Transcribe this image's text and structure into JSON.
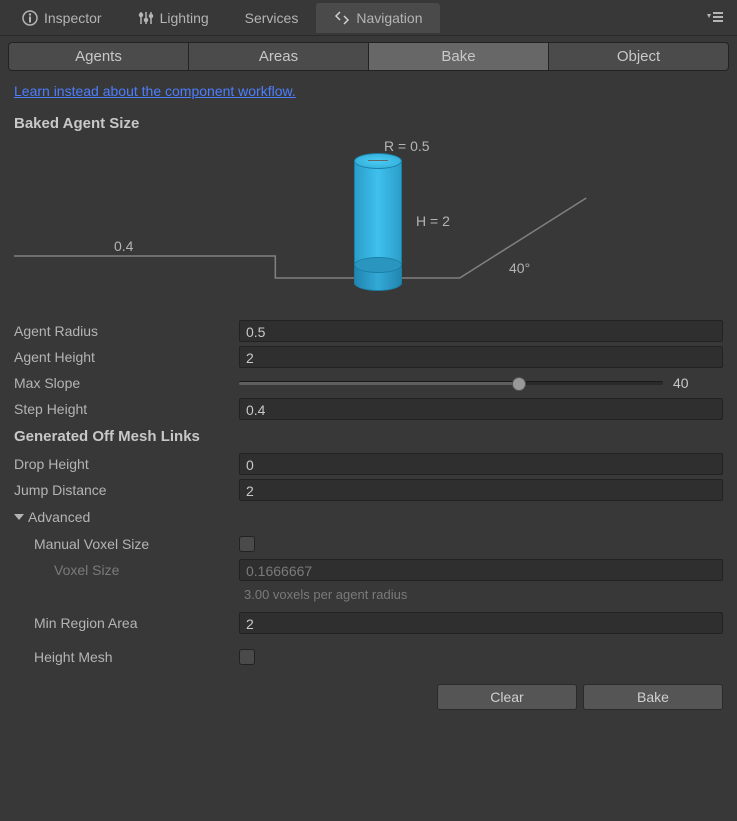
{
  "topTabs": {
    "inspector": "Inspector",
    "lighting": "Lighting",
    "services": "Services",
    "navigation": "Navigation"
  },
  "subTabs": {
    "agents": "Agents",
    "areas": "Areas",
    "bake": "Bake",
    "object": "Object"
  },
  "link": "Learn instead about the component workflow.",
  "sections": {
    "bakedAgent": "Baked Agent Size",
    "offMeshLinks": "Generated Off Mesh Links",
    "advanced": "Advanced"
  },
  "diagram": {
    "radiusLabel": "R = 0.5",
    "heightLabel": "H = 2",
    "stepLabel": "0.4",
    "slopeLabel": "40°"
  },
  "props": {
    "agentRadius": {
      "label": "Agent Radius",
      "value": "0.5"
    },
    "agentHeight": {
      "label": "Agent Height",
      "value": "2"
    },
    "maxSlope": {
      "label": "Max Slope",
      "value": "40"
    },
    "stepHeight": {
      "label": "Step Height",
      "value": "0.4"
    },
    "dropHeight": {
      "label": "Drop Height",
      "value": "0"
    },
    "jumpDistance": {
      "label": "Jump Distance",
      "value": "2"
    },
    "manualVoxel": {
      "label": "Manual Voxel Size"
    },
    "voxelSize": {
      "label": "Voxel Size",
      "value": "0.1666667"
    },
    "voxelHint": "3.00 voxels per agent radius",
    "minRegionArea": {
      "label": "Min Region Area",
      "value": "2"
    },
    "heightMesh": {
      "label": "Height Mesh"
    }
  },
  "buttons": {
    "clear": "Clear",
    "bake": "Bake"
  }
}
